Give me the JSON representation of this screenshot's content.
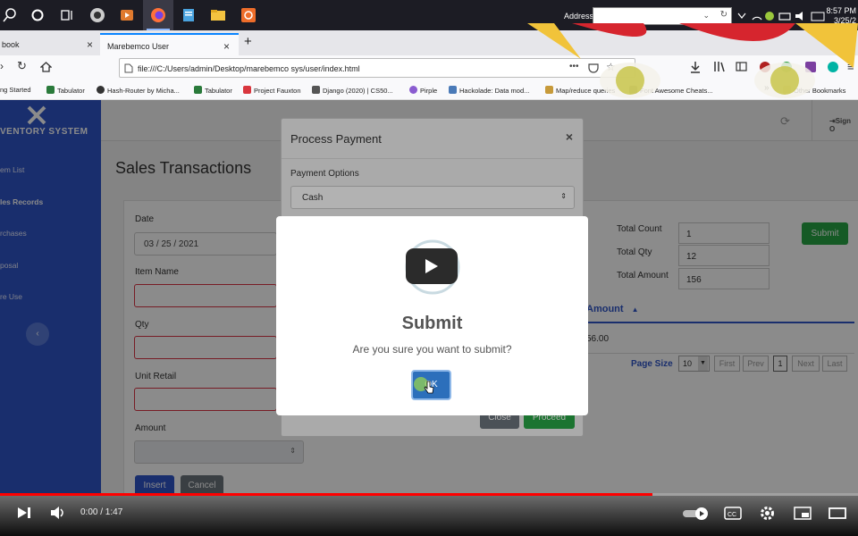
{
  "os": {
    "address_label": "Address",
    "clock_time": "8:57 PM",
    "clock_date": "3/25/2"
  },
  "browser": {
    "tabs": [
      {
        "label": "book"
      },
      {
        "label": "Marebemco User"
      }
    ],
    "url": "file:///C:/Users/admin/Desktop/marebemco sys/user/index.html",
    "bookmarks": [
      "ng Started",
      "Tabulator",
      "Hash-Router by Micha...",
      "Tabulator",
      "Project Fauxton",
      "Django (2020) | CS50...",
      "Pirple",
      "Hackolade: Data mod...",
      "Map/reduce queries",
      "Font Awesome Cheats...",
      "Other Bookmarks"
    ]
  },
  "app": {
    "brand": "VENTORY SYSTEM",
    "sidebar_items": [
      {
        "label": "em List"
      },
      {
        "label": "les Records"
      },
      {
        "label": "rchases"
      },
      {
        "label": "posal"
      },
      {
        "label": "re Use"
      }
    ],
    "topbar_action": "Sign O",
    "page_title": "Sales Transactions",
    "form": {
      "date_label": "Date",
      "date_value": "03 / 25 / 2021",
      "item_label": "Item Name",
      "qty_label": "Qty",
      "retail_label": "Unit Retail",
      "amount_label": "Amount",
      "insert_label": "Insert",
      "cancel_label": "Cancel"
    },
    "totals": {
      "count_label": "Total Count",
      "count_value": "1",
      "qty_label": "Total Qty",
      "qty_value": "12",
      "amount_label": "Total Amount",
      "amount_value": "156",
      "submit_label": "Submit"
    },
    "grid": {
      "column_header": "Amount",
      "sort_indicator": "▲",
      "cell_value": "56.00",
      "page_size_label": "Page Size",
      "page_size_value": "10",
      "pager": [
        "First",
        "Prev",
        "1",
        "Next",
        "Last"
      ]
    }
  },
  "payment_modal": {
    "title": "Process Payment",
    "close": "×",
    "options_label": "Payment Options",
    "options_value": "Cash",
    "close_button": "Close",
    "proceed_button": "Proceed"
  },
  "confirm_dialog": {
    "title": "Submit",
    "message": "Are you sure you want to submit?",
    "ok_label": "OK"
  },
  "video": {
    "time": "0:00 / 1:47",
    "progress": 0.76
  },
  "colors": {
    "sidebar": "#2f55c8",
    "submit_green": "#28a745",
    "ok_blue": "#2c6fbb",
    "invalid_red": "#dc3545"
  }
}
